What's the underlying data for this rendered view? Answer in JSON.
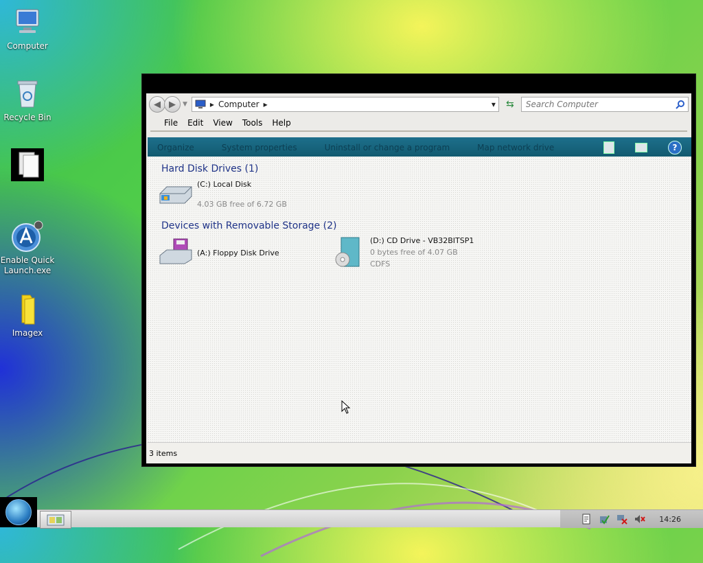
{
  "desktop": {
    "icons": [
      {
        "label": "Computer",
        "icon": "computer-icon"
      },
      {
        "label": "Recycle Bin",
        "icon": "recycle-bin-icon"
      },
      {
        "label": "",
        "icon": "documents-icon"
      },
      {
        "label": "Enable Quick Launch.exe",
        "icon": "quick-launch-icon"
      },
      {
        "label": "Imagex",
        "icon": "folder-icon"
      }
    ]
  },
  "window": {
    "title": "",
    "address": {
      "crumbs": [
        "Computer"
      ]
    },
    "search": {
      "placeholder": "Search Computer"
    },
    "menu": [
      "File",
      "Edit",
      "View",
      "Tools",
      "Help"
    ],
    "commands": [
      "Organize",
      "System properties",
      "Uninstall or change a program",
      "Map network drive"
    ],
    "groups": [
      {
        "title": "Hard Disk Drives (1)",
        "items": [
          {
            "name": "(C:) Local Disk",
            "detail": "4.03 GB free of 6.72 GB"
          }
        ]
      },
      {
        "title": "Devices with Removable Storage (2)",
        "items": [
          {
            "name": "(A:) Floppy Disk Drive"
          },
          {
            "name": "(D:) CD Drive - VB32BITSP1",
            "detail": "0 bytes free of 4.07 GB",
            "detail2": "CDFS"
          }
        ]
      }
    ],
    "status": "3 items"
  },
  "taskbar": {
    "clock": "14:26"
  },
  "colors": {
    "command_bar": "#1d6f8c",
    "group_heading": "#1e3287"
  }
}
